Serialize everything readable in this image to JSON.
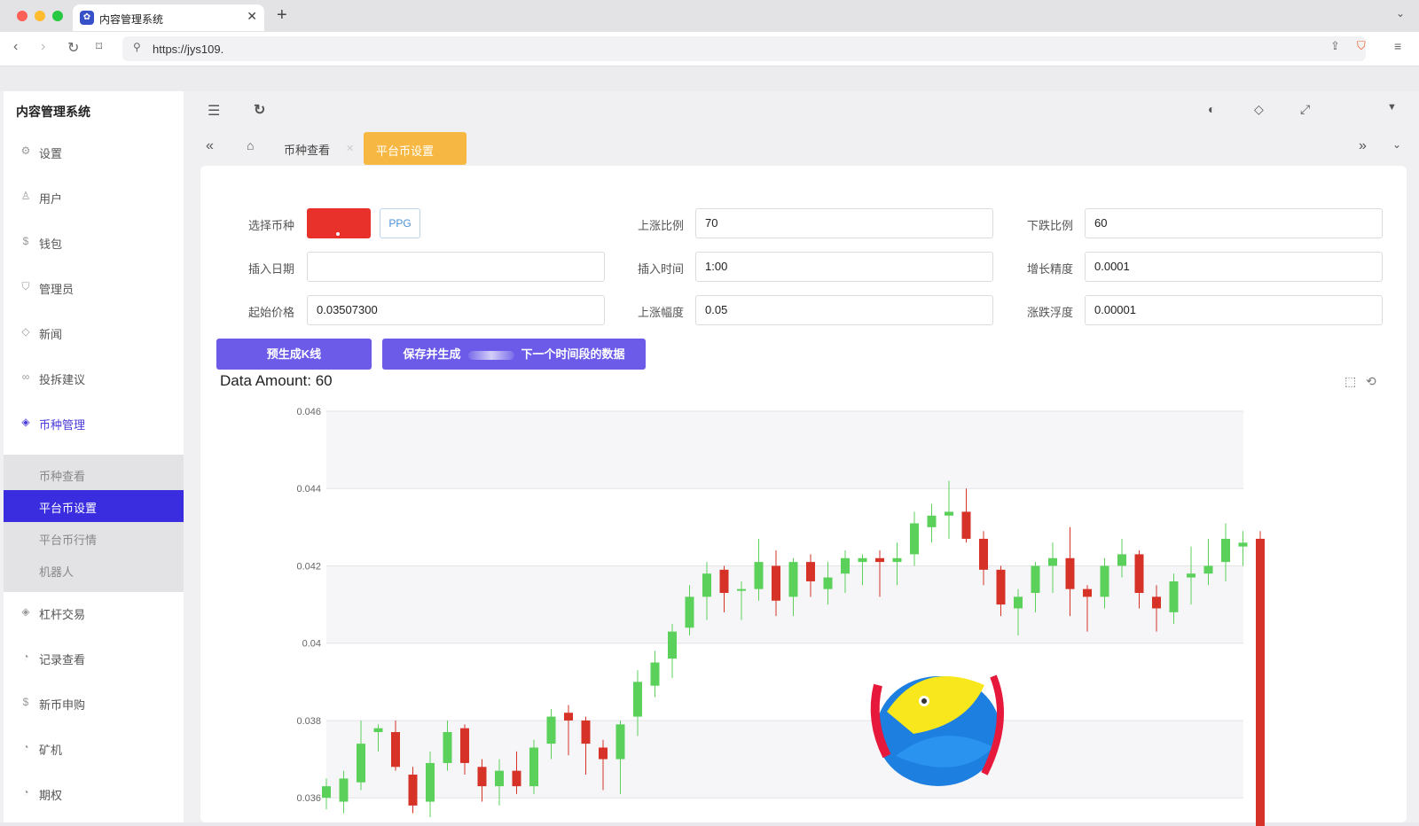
{
  "browser": {
    "tab_title": "内容管理系统",
    "tab_favicon": "app-icon",
    "url": "https://jys109."
  },
  "app": {
    "brand": "内容管理系统",
    "sidebar": [
      {
        "label": "设置",
        "icon": "gear-icon"
      },
      {
        "label": "用户",
        "icon": "user-icon"
      },
      {
        "label": "钱包",
        "icon": "wallet-icon"
      },
      {
        "label": "管理员",
        "icon": "shield-icon"
      },
      {
        "label": "新闻",
        "icon": "tag-icon"
      },
      {
        "label": "投拆建议",
        "icon": "link-icon"
      },
      {
        "label": "币种管理",
        "icon": "diamond-icon",
        "active": true
      },
      {
        "label": "杠杆交易",
        "icon": "diamond-icon"
      },
      {
        "label": "记录查看",
        "icon": "clock-icon"
      },
      {
        "label": "新币申购",
        "icon": "coin-icon"
      },
      {
        "label": "矿机",
        "icon": "clock-icon"
      },
      {
        "label": "期权",
        "icon": "clock-icon"
      }
    ],
    "submenu": [
      {
        "label": "币种查看"
      },
      {
        "label": "平台币设置",
        "selected": true
      },
      {
        "label": "平台币行情"
      },
      {
        "label": "机器人"
      }
    ],
    "header": {
      "tabs": [
        {
          "label": "币种查看"
        },
        {
          "label": "平台币设置",
          "active": true
        }
      ]
    },
    "form": {
      "select_coin_label": "选择币种",
      "coin_button": "PPG",
      "up_ratio_label": "上涨比例",
      "up_ratio_value": "70",
      "down_ratio_label": "下跌比例",
      "down_ratio_value": "60",
      "insert_date_label": "插入日期",
      "insert_date_value": "",
      "insert_time_label": "插入时间",
      "insert_time_value": "1:00",
      "growth_precision_label": "增长精度",
      "growth_precision_value": "0.0001",
      "start_price_label": "起始价格",
      "start_price_value": "0.03507300",
      "up_amplitude_label": "上涨幅度",
      "up_amplitude_value": "0.05",
      "fluctuation_label": "涨跌浮度",
      "fluctuation_value": "0.00001",
      "btn_pregenerate": "预生成K线",
      "btn_save_prefix": "保存并生成",
      "btn_save_suffix": "下一个时间段的数据"
    },
    "data_amount": "Data Amount: 60"
  },
  "colors": {
    "accent": "#3a2de0",
    "button": "#6b5be8",
    "tab_active": "#f6b843",
    "up": "#5bd15b",
    "down": "#d63228"
  },
  "chart_data": {
    "type": "candlestick",
    "ylim": [
      0.0355,
      0.046
    ],
    "y_ticks": [
      "0.046",
      "0.044",
      "0.042",
      "0.04",
      "0.038",
      "0.036"
    ],
    "y_tick_values": [
      0.046,
      0.044,
      0.042,
      0.04,
      0.038,
      0.036
    ],
    "candles": [
      [
        0.036,
        0.0363,
        0.0357,
        0.0365
      ],
      [
        0.0359,
        0.0365,
        0.0356,
        0.0367
      ],
      [
        0.0364,
        0.0374,
        0.0362,
        0.038
      ],
      [
        0.0377,
        0.0378,
        0.0372,
        0.0379
      ],
      [
        0.0377,
        0.0368,
        0.0367,
        0.038
      ],
      [
        0.0366,
        0.0358,
        0.0356,
        0.0368
      ],
      [
        0.0359,
        0.0369,
        0.0355,
        0.0372
      ],
      [
        0.0369,
        0.0377,
        0.0367,
        0.038
      ],
      [
        0.0378,
        0.0369,
        0.0366,
        0.0379
      ],
      [
        0.0368,
        0.0363,
        0.0359,
        0.037
      ],
      [
        0.0363,
        0.0367,
        0.0358,
        0.037
      ],
      [
        0.0367,
        0.0363,
        0.0361,
        0.0372
      ],
      [
        0.0363,
        0.0373,
        0.0361,
        0.0375
      ],
      [
        0.0374,
        0.0381,
        0.037,
        0.0383
      ],
      [
        0.0382,
        0.038,
        0.0371,
        0.0384
      ],
      [
        0.038,
        0.0374,
        0.0366,
        0.0381
      ],
      [
        0.0373,
        0.037,
        0.0362,
        0.0375
      ],
      [
        0.037,
        0.0379,
        0.0361,
        0.038
      ],
      [
        0.0381,
        0.039,
        0.0376,
        0.0393
      ],
      [
        0.0389,
        0.0395,
        0.0386,
        0.0398
      ],
      [
        0.0396,
        0.0403,
        0.0391,
        0.0405
      ],
      [
        0.0404,
        0.0412,
        0.0402,
        0.0415
      ],
      [
        0.0412,
        0.0418,
        0.0406,
        0.0421
      ],
      [
        0.0419,
        0.0413,
        0.0408,
        0.042
      ],
      [
        0.0414,
        0.0414,
        0.0406,
        0.0416
      ],
      [
        0.0414,
        0.0421,
        0.0411,
        0.0427
      ],
      [
        0.042,
        0.0411,
        0.0407,
        0.0424
      ],
      [
        0.0412,
        0.0421,
        0.0407,
        0.0422
      ],
      [
        0.0421,
        0.0416,
        0.0412,
        0.0423
      ],
      [
        0.0414,
        0.0417,
        0.041,
        0.0421
      ],
      [
        0.0418,
        0.0422,
        0.0413,
        0.0424
      ],
      [
        0.0421,
        0.0422,
        0.0415,
        0.0423
      ],
      [
        0.0422,
        0.0421,
        0.0412,
        0.0424
      ],
      [
        0.0421,
        0.0422,
        0.0415,
        0.0426
      ],
      [
        0.0423,
        0.0431,
        0.042,
        0.0434
      ],
      [
        0.043,
        0.0433,
        0.0426,
        0.0436
      ],
      [
        0.0433,
        0.0434,
        0.0427,
        0.0442
      ],
      [
        0.0434,
        0.0427,
        0.0426,
        0.044
      ],
      [
        0.0427,
        0.0419,
        0.0415,
        0.0429
      ],
      [
        0.0419,
        0.041,
        0.0407,
        0.042
      ],
      [
        0.0409,
        0.0412,
        0.0402,
        0.0414
      ],
      [
        0.0413,
        0.042,
        0.0408,
        0.0421
      ],
      [
        0.042,
        0.0422,
        0.0413,
        0.0426
      ],
      [
        0.0422,
        0.0414,
        0.0407,
        0.043
      ],
      [
        0.0414,
        0.0412,
        0.0403,
        0.0415
      ],
      [
        0.0412,
        0.042,
        0.0409,
        0.0422
      ],
      [
        0.042,
        0.0423,
        0.0417,
        0.0427
      ],
      [
        0.0423,
        0.0413,
        0.0409,
        0.0424
      ],
      [
        0.0412,
        0.0409,
        0.0403,
        0.0415
      ],
      [
        0.0408,
        0.0416,
        0.0405,
        0.0418
      ],
      [
        0.0417,
        0.0418,
        0.041,
        0.0425
      ],
      [
        0.0418,
        0.042,
        0.0415,
        0.0427
      ],
      [
        0.0421,
        0.0427,
        0.0416,
        0.0431
      ],
      [
        0.0425,
        0.0426,
        0.042,
        0.0429
      ],
      [
        0.0427,
        0.0346,
        0.034,
        0.0429
      ]
    ],
    "grid": true
  }
}
